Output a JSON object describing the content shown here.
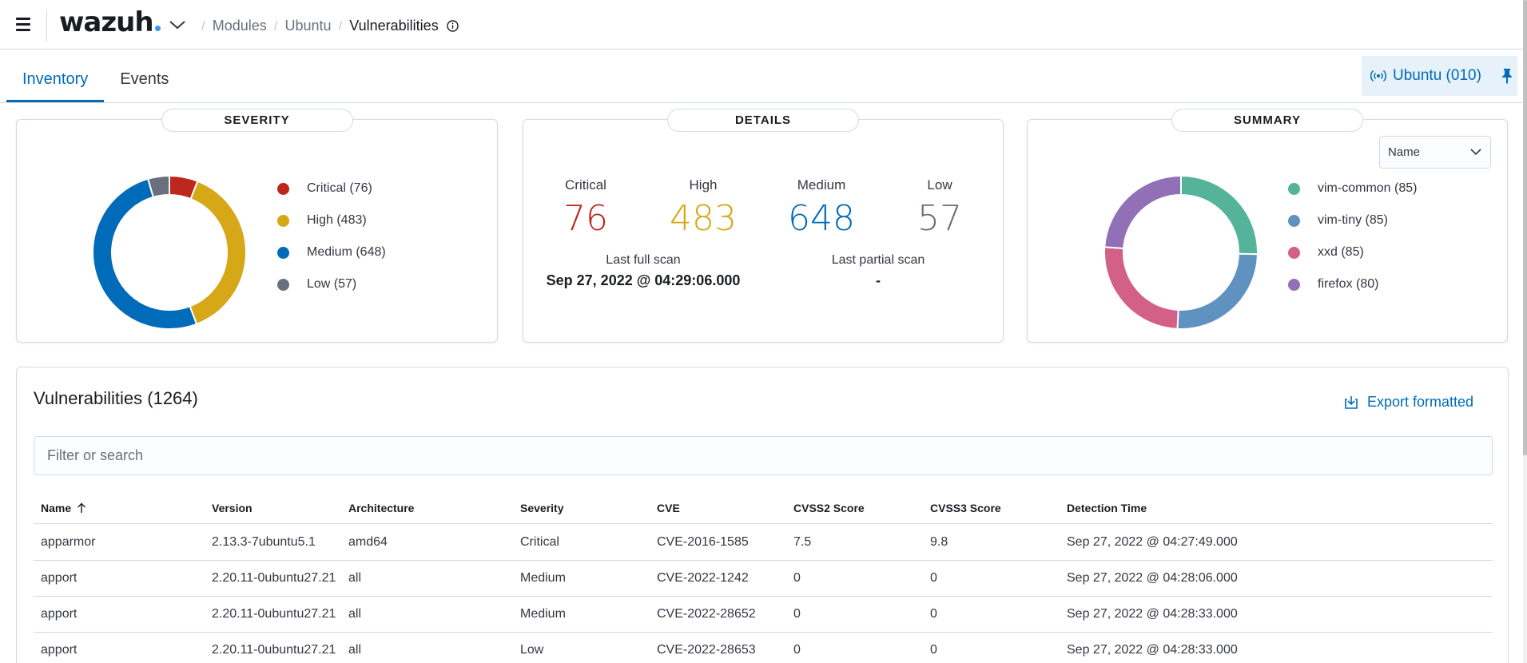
{
  "header": {
    "logo": "wazuh",
    "breadcrumb": [
      "Modules",
      "Ubuntu",
      "Vulnerabilities"
    ]
  },
  "tabs": [
    "Inventory",
    "Events"
  ],
  "agent_badge": "Ubuntu (010)",
  "severity_panel": {
    "title": "SEVERITY",
    "legend": [
      "Critical (76)",
      "High (483)",
      "Medium (648)",
      "Low (57)"
    ]
  },
  "details_panel": {
    "title": "DETAILS",
    "columns": [
      {
        "label": "Critical",
        "value": "76"
      },
      {
        "label": "High",
        "value": "483"
      },
      {
        "label": "Medium",
        "value": "648"
      },
      {
        "label": "Low",
        "value": "57"
      }
    ],
    "last_full_scan_label": "Last full scan",
    "last_full_scan_value": "Sep 27, 2022 @ 04:29:06.000",
    "last_partial_scan_label": "Last partial scan",
    "last_partial_scan_value": "-"
  },
  "summary_panel": {
    "title": "SUMMARY",
    "select_value": "Name",
    "legend": [
      "vim-common (85)",
      "vim-tiny (85)",
      "xxd (85)",
      "firefox (80)"
    ]
  },
  "chart_data": [
    {
      "type": "pie",
      "categories": [
        "Critical",
        "High",
        "Medium",
        "Low"
      ],
      "values": [
        76,
        483,
        648,
        57
      ],
      "colors": [
        "#bd271e",
        "#d6a717",
        "#006bb8",
        "#69707d"
      ]
    },
    {
      "type": "pie",
      "categories": [
        "vim-common",
        "vim-tiny",
        "xxd",
        "firefox"
      ],
      "values": [
        85,
        85,
        85,
        80
      ],
      "colors": [
        "#54b399",
        "#6092c0",
        "#d36086",
        "#9170b8"
      ]
    }
  ],
  "colors": {
    "critical": "#bd271e",
    "high": "#d6a717",
    "medium": "#006bb8",
    "low": "#69707d",
    "accent": "#006bb8"
  },
  "table": {
    "title": "Vulnerabilities (1264)",
    "export_label": "Export formatted",
    "search_placeholder": "Filter or search",
    "columns": [
      "Name",
      "Version",
      "Architecture",
      "Severity",
      "CVE",
      "CVSS2 Score",
      "CVSS3 Score",
      "Detection Time"
    ],
    "rows": [
      [
        "apparmor",
        "2.13.3-7ubuntu5.1",
        "amd64",
        "Critical",
        "CVE-2016-1585",
        "7.5",
        "9.8",
        "Sep 27, 2022 @ 04:27:49.000"
      ],
      [
        "apport",
        "2.20.11-0ubuntu27.21",
        "all",
        "Medium",
        "CVE-2022-1242",
        "0",
        "0",
        "Sep 27, 2022 @ 04:28:06.000"
      ],
      [
        "apport",
        "2.20.11-0ubuntu27.21",
        "all",
        "Medium",
        "CVE-2022-28652",
        "0",
        "0",
        "Sep 27, 2022 @ 04:28:33.000"
      ],
      [
        "apport",
        "2.20.11-0ubuntu27.21",
        "all",
        "Low",
        "CVE-2022-28653",
        "0",
        "0",
        "Sep 27, 2022 @ 04:28:33.000"
      ]
    ]
  }
}
